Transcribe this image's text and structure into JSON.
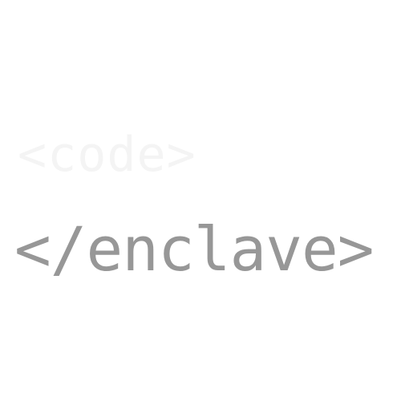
{
  "logo": {
    "faint_text": "<code>",
    "main_text": "</enclave>",
    "colors": {
      "background": "#ffffff",
      "main_text": "#979797",
      "faint_text": "#f4f4f4"
    }
  }
}
